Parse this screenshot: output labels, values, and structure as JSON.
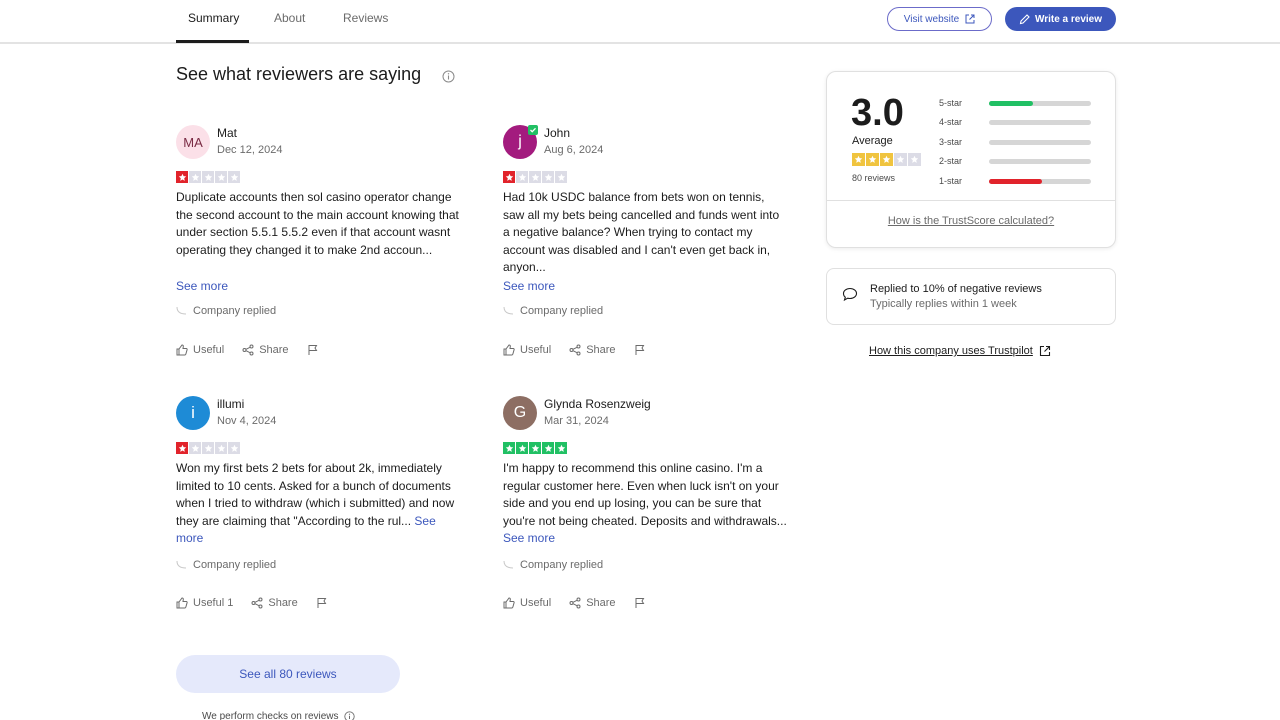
{
  "nav": {
    "tabs": [
      {
        "label": "Summary"
      },
      {
        "label": "About"
      },
      {
        "label": "Reviews"
      }
    ],
    "visit_label": "Visit website",
    "write_label": "Write a review"
  },
  "section_title": "See what reviewers are saying",
  "reviews": [
    {
      "initials": "MA",
      "name": "Mat",
      "date": "Dec 12, 2024",
      "rating": 1,
      "text": "Duplicate accounts then sol casino operator change the second account to the main account knowing that under section 5.5.1 5.5.2 even if that account wasnt operating they changed it to make 2nd accoun...",
      "see_more": "See more",
      "replied": "Company replied",
      "useful": "Useful",
      "share": "Share"
    },
    {
      "initials": "j",
      "name": "John",
      "date": "Aug 6, 2024",
      "rating": 1,
      "text": "Had 10k USDC balance from bets won on tennis, saw all my bets being cancelled and funds went into a negative balance? When trying to contact my account was disabled and I can't even get back in, anyon...",
      "see_more": "See more",
      "replied": "Company replied",
      "useful": "Useful",
      "share": "Share"
    },
    {
      "initials": "i",
      "name": "illumi",
      "date": "Nov 4, 2024",
      "rating": 1,
      "text": "Won my first bets 2 bets for about 2k, immediately limited to 10 cents. Asked for a bunch of documents when I tried to withdraw (which i submitted) and now they are claiming that \"According to the rul...",
      "see_more": "See more",
      "replied": "Company replied",
      "useful": "Useful 1",
      "share": "Share"
    },
    {
      "initials": "G",
      "name": "Glynda Rosenzweig",
      "date": "Mar 31, 2024",
      "rating": 5,
      "text": "I'm happy to recommend this online casino. I'm a regular customer here. Even when luck isn't on your side and you end up losing, you can be sure that you're not being cheated. Deposits and withdrawals...",
      "see_more": "See more",
      "replied": "Company replied",
      "useful": "Useful",
      "share": "Share"
    }
  ],
  "score": {
    "value": "3.0",
    "avg_label": "Average",
    "rating": 3,
    "count_label": "80 reviews",
    "bars": [
      {
        "label": "5-star",
        "fraction": 0.43,
        "color": "#21c064"
      },
      {
        "label": "4-star",
        "fraction": 0.0,
        "color": "#21c064"
      },
      {
        "label": "3-star",
        "fraction": 0.0,
        "color": "#21c064"
      },
      {
        "label": "2-star",
        "fraction": 0.0,
        "color": "#21c064"
      },
      {
        "label": "1-star",
        "fraction": 0.52,
        "color": "#e1232b"
      }
    ],
    "trust_link": "How is the TrustScore calculated?"
  },
  "reply_stats": {
    "line1": "Replied to 10% of negative reviews",
    "line2": "Typically replies within 1 week"
  },
  "company_link": "How this company uses Trustpilot",
  "see_all": "See all 80 reviews",
  "checks": "We perform checks on reviews",
  "colors": {
    "accent": "#3c57bc",
    "star_red": "#e1232b",
    "star_green": "#21c064",
    "star_yellow": "#f0c43f",
    "star_empty": "#dcdce6"
  }
}
